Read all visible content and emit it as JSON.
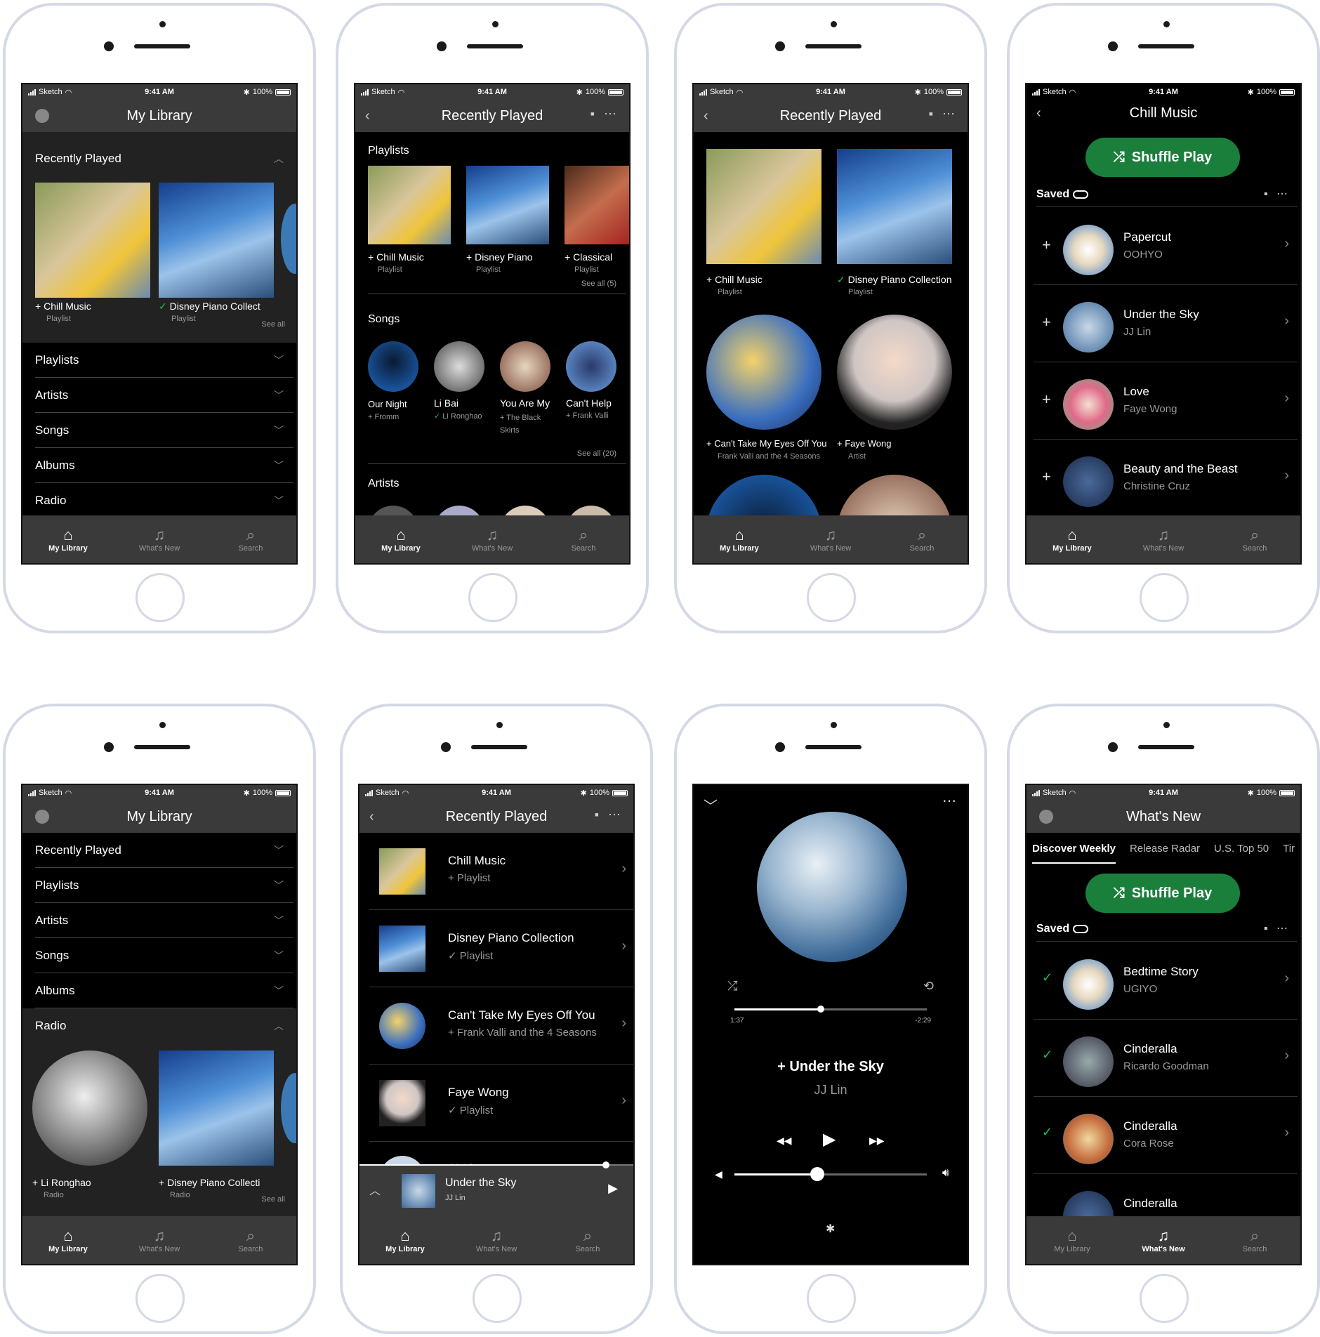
{
  "status": {
    "carrier": "Sketch",
    "time": "9:41 AM",
    "battery": "100%"
  },
  "tabs": {
    "library": "My Library",
    "whatsnew": "What's New",
    "search": "Search"
  },
  "colors": {
    "accent_green": "#1a7f3b",
    "bar_gray": "#3a3a3a"
  },
  "screen1": {
    "title": "My Library",
    "recently_played": "Recently Played",
    "items": [
      {
        "name": "Chill Music",
        "type": "Playlist"
      },
      {
        "name": "Disney Piano Collect",
        "type": "Playlist"
      }
    ],
    "see_all": "See all",
    "sections": [
      "Playlists",
      "Artists",
      "Songs",
      "Albums",
      "Radio"
    ]
  },
  "screen2": {
    "title": "Recently Played",
    "playlists_label": "Playlists",
    "playlists": [
      {
        "name": "Chill Music",
        "type": "Playlist"
      },
      {
        "name": "Disney Piano",
        "type": "Playlist"
      },
      {
        "name": "Classical",
        "type": "Playlist"
      }
    ],
    "playlists_see_all": "See all (5)",
    "songs_label": "Songs",
    "songs": [
      {
        "name": "Our Night",
        "artist": "Fromm"
      },
      {
        "name": "Li Bai",
        "artist": "Li Ronghao"
      },
      {
        "name": "You Are My",
        "artist": "The Black Skirts"
      },
      {
        "name": "Can't Help",
        "artist": "Frank Valli"
      }
    ],
    "songs_see_all": "See all (20)",
    "artists_label": "Artists"
  },
  "screen3": {
    "title": "Recently Played",
    "items": [
      {
        "name": "Chill Music",
        "sub": "Playlist"
      },
      {
        "name": "Disney Piano Collection",
        "sub": "Playlist"
      },
      {
        "name": "Can't Take My Eyes Off You",
        "sub": "Frank Valli and the 4 Seasons"
      },
      {
        "name": "Faye Wong",
        "sub": "Artist"
      }
    ]
  },
  "screen4": {
    "title": "Chill Music",
    "shuffle": "Shuffle Play",
    "saved": "Saved",
    "tracks": [
      {
        "title": "Papercut",
        "artist": "OOHYO"
      },
      {
        "title": "Under the Sky",
        "artist": "JJ Lin"
      },
      {
        "title": "Love",
        "artist": "Faye Wong"
      },
      {
        "title": "Beauty and the Beast",
        "artist": "Christine Cruz"
      }
    ]
  },
  "screen5": {
    "title": "My Library",
    "sections": [
      "Recently Played",
      "Playlists",
      "Artists",
      "Songs",
      "Albums",
      "Radio"
    ],
    "items": [
      {
        "name": "Li Ronghao",
        "type": "Radio"
      },
      {
        "name": "Disney Piano Collecti",
        "type": "Radio"
      }
    ],
    "see_all": "See all"
  },
  "screen6": {
    "title": "Recently Played",
    "items": [
      {
        "title": "Chill Music",
        "sub": "+ Playlist"
      },
      {
        "title": "Disney Piano Collection",
        "sub": "✓ Playlist"
      },
      {
        "title": "Can't Take My Eyes Off You",
        "sub": "+ Frank Valli and the 4 Seasons"
      },
      {
        "title": "Faye Wong",
        "sub": "✓ Playlist"
      }
    ],
    "next_partial": "JJ Lin",
    "player": {
      "title": "Under the Sky",
      "artist": "JJ Lin",
      "progress": 0.9
    }
  },
  "screen7": {
    "elapsed": "1:37",
    "remaining": "-2:29",
    "title": "Under the Sky",
    "artist": "JJ Lin",
    "progress": 0.45,
    "volume": 0.43
  },
  "screen8": {
    "title": "What's New",
    "subtabs": [
      "Discover Weekly",
      "Release Radar",
      "U.S. Top 50",
      "Tir"
    ],
    "shuffle": "Shuffle Play",
    "saved": "Saved",
    "tracks": [
      {
        "title": "Bedtime Story",
        "artist": "UGIYO"
      },
      {
        "title": "Cinderalla",
        "artist": "Ricardo Goodman"
      },
      {
        "title": "Cinderalla",
        "artist": "Cora Rose"
      },
      {
        "title": "Cinderalla",
        "artist": ""
      }
    ]
  }
}
